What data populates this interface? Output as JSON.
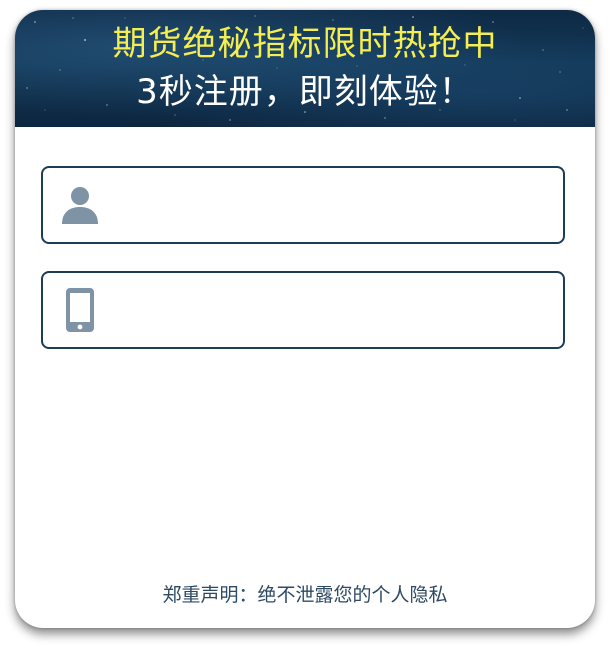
{
  "banner": {
    "title": "期货绝秘指标限时热抢中",
    "subtitle": "3秒注册，即刻体验！"
  },
  "form": {
    "name_field": {
      "icon": "user-icon",
      "value": "",
      "placeholder": ""
    },
    "phone_field": {
      "icon": "mobile-phone-icon",
      "value": "",
      "placeholder": ""
    }
  },
  "footer": {
    "disclaimer": "郑重声明：绝不泄露您的个人隐私"
  },
  "colors": {
    "title_yellow": "#f4ee52",
    "banner_dark": "#0e2a45",
    "field_border": "#1d3d55",
    "icon_gray": "#7f93a6",
    "disclaimer_text": "#2e4a63"
  }
}
